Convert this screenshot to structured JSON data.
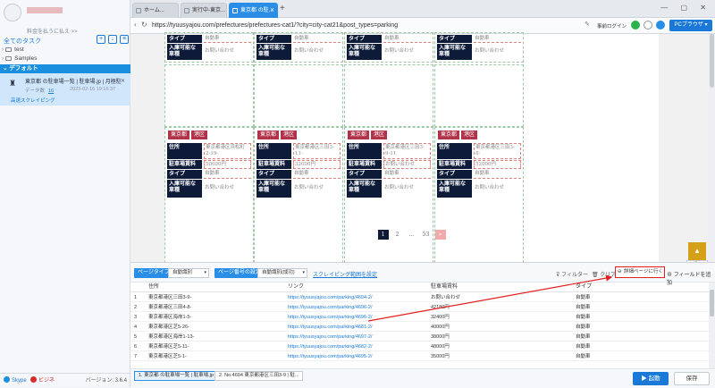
{
  "sidebar": {
    "upgrade_text": "料金を払うに払え >>",
    "all_tasks": "全てのタスク",
    "tree": [
      {
        "label": "test"
      },
      {
        "label": "Samples"
      }
    ],
    "default_group": "デフォルト",
    "task": {
      "title": "東京都 の駐車場一覧 | 駐車場.jp | 月極駐車場",
      "data_label": "データ数",
      "data_count": "16",
      "date": "2023-02-16 19:16:37",
      "sub": "高速スクレイピング"
    },
    "footer": {
      "skype": "Skype",
      "biz": "ビジネ",
      "version": "バージョン: 3.6.4"
    }
  },
  "browser": {
    "tabs": [
      {
        "label": "ホーム..."
      },
      {
        "label": "実行中-東京..."
      },
      {
        "label": "東京都 の駐..."
      }
    ],
    "url": "https://tyuusyajou.com/prefectures/prefectures-cat1/?city=city-cat21&post_types=parking",
    "login": "事前ログイン",
    "pc_browser": "PCブラウザ"
  },
  "page": {
    "top_cards": [
      {
        "type_label": "タイプ",
        "type_val": "自動車",
        "entry_label": "入庫可能な車種",
        "entry_val": "お問い合わせ"
      },
      {
        "type_label": "タイプ",
        "type_val": "自動車",
        "entry_label": "入庫可能な車種",
        "entry_val": "お問い合わせ"
      },
      {
        "type_label": "タイプ",
        "type_val": "自動車",
        "entry_label": "入庫可能な車種",
        "entry_val": "お問い合わせ"
      },
      {
        "type_label": "タイプ",
        "type_val": "自動車",
        "entry_label": "入庫可能な車種",
        "entry_val": "お問い合わせ"
      }
    ],
    "cards": [
      {
        "pref": "東京都",
        "ward": "港区",
        "addr_label": "住所",
        "addr": "東京都港区浜松町2-19-",
        "fee_label": "駐車場賃料",
        "fee": "50000円",
        "type_label": "タイプ",
        "type": "自動車",
        "entry_label": "入庫可能な車種",
        "entry": "お問い合わせ"
      },
      {
        "pref": "東京都",
        "ward": "港区",
        "addr_label": "住所",
        "addr": "東京都港区三田3-11-",
        "fee_label": "駐車場賃料",
        "fee": "32000円",
        "type_label": "タイプ",
        "type": "自動車",
        "entry_label": "入庫可能な車種",
        "entry": "お問い合わせ"
      },
      {
        "pref": "東京都",
        "ward": "港区",
        "addr_label": "住所",
        "addr": "東京都港区三田3-9-11",
        "fee_label": "駐車場賃料",
        "fee": "お問い合わせ",
        "type_label": "タイプ",
        "type": "自動車",
        "entry_label": "入庫可能な車種",
        "entry": "お問い合わせ"
      },
      {
        "pref": "東京都",
        "ward": "港区",
        "addr_label": "住所",
        "addr": "東京都港区三田3-8-",
        "fee_label": "駐車場賃料",
        "fee": "52000円",
        "type_label": "タイプ",
        "type": "自動車",
        "entry_label": "入庫可能な車種",
        "entry": "お問い合わせ"
      }
    ],
    "pager": [
      "1",
      "2",
      "...",
      "53",
      "»"
    ],
    "shrink": "折る"
  },
  "panel": {
    "page_type_label": "ページタイプ",
    "page_type_value": "自動識別",
    "page_count_label": "ページ番号の設定",
    "page_count_value": "自動識別(成功)",
    "scrape_range": "スクレイピング範囲を設定",
    "filter": "フィルター",
    "clear": "クリア",
    "detail": "詳細ページに行く",
    "add_field": "フィールドを追加",
    "headers": [
      "住所",
      "リンク",
      "駐車場賃料",
      "タイプ"
    ],
    "rows": [
      {
        "n": "1",
        "addr": "東京都港区三田3-9-",
        "link": "https://tyuusyajou.com/parking/4694-2/",
        "fee": "お問い合わせ",
        "type": "自動車"
      },
      {
        "n": "2",
        "addr": "東京都港区三田4-8-",
        "link": "https://tyuusyajou.com/parking/4696-2/",
        "fee": "42180円",
        "type": "自動車"
      },
      {
        "n": "3",
        "addr": "東京都港区海岸1-5-",
        "link": "https://tyuusyajou.com/parking/4696-2/",
        "fee": "32400円",
        "type": "自動車"
      },
      {
        "n": "4",
        "addr": "東京都港区芝5-26-",
        "link": "https://tyuusyajou.com/parking/4681-2/",
        "fee": "40000円",
        "type": "自動車"
      },
      {
        "n": "5",
        "addr": "東京都港区海岸1-13-",
        "link": "https://tyuusyajou.com/parking/4697-2/",
        "fee": "38000円",
        "type": "自動車"
      },
      {
        "n": "6",
        "addr": "東京都港区芝5-11-",
        "link": "https://tyuusyajou.com/parking/4682-2/",
        "fee": "48000円",
        "type": "自動車"
      },
      {
        "n": "7",
        "addr": "東京都港区芝5-1-",
        "link": "https://tyuusyajou.com/parking/4695-2/",
        "fee": "35000円",
        "type": "自動車"
      }
    ],
    "bottom_tabs": [
      "1. 東京都 の駐車場一覧 | 駐車場.jp",
      "2. No.4694 東京都港区三田3-9 | 駐..."
    ],
    "start": "起動",
    "save": "保存"
  }
}
